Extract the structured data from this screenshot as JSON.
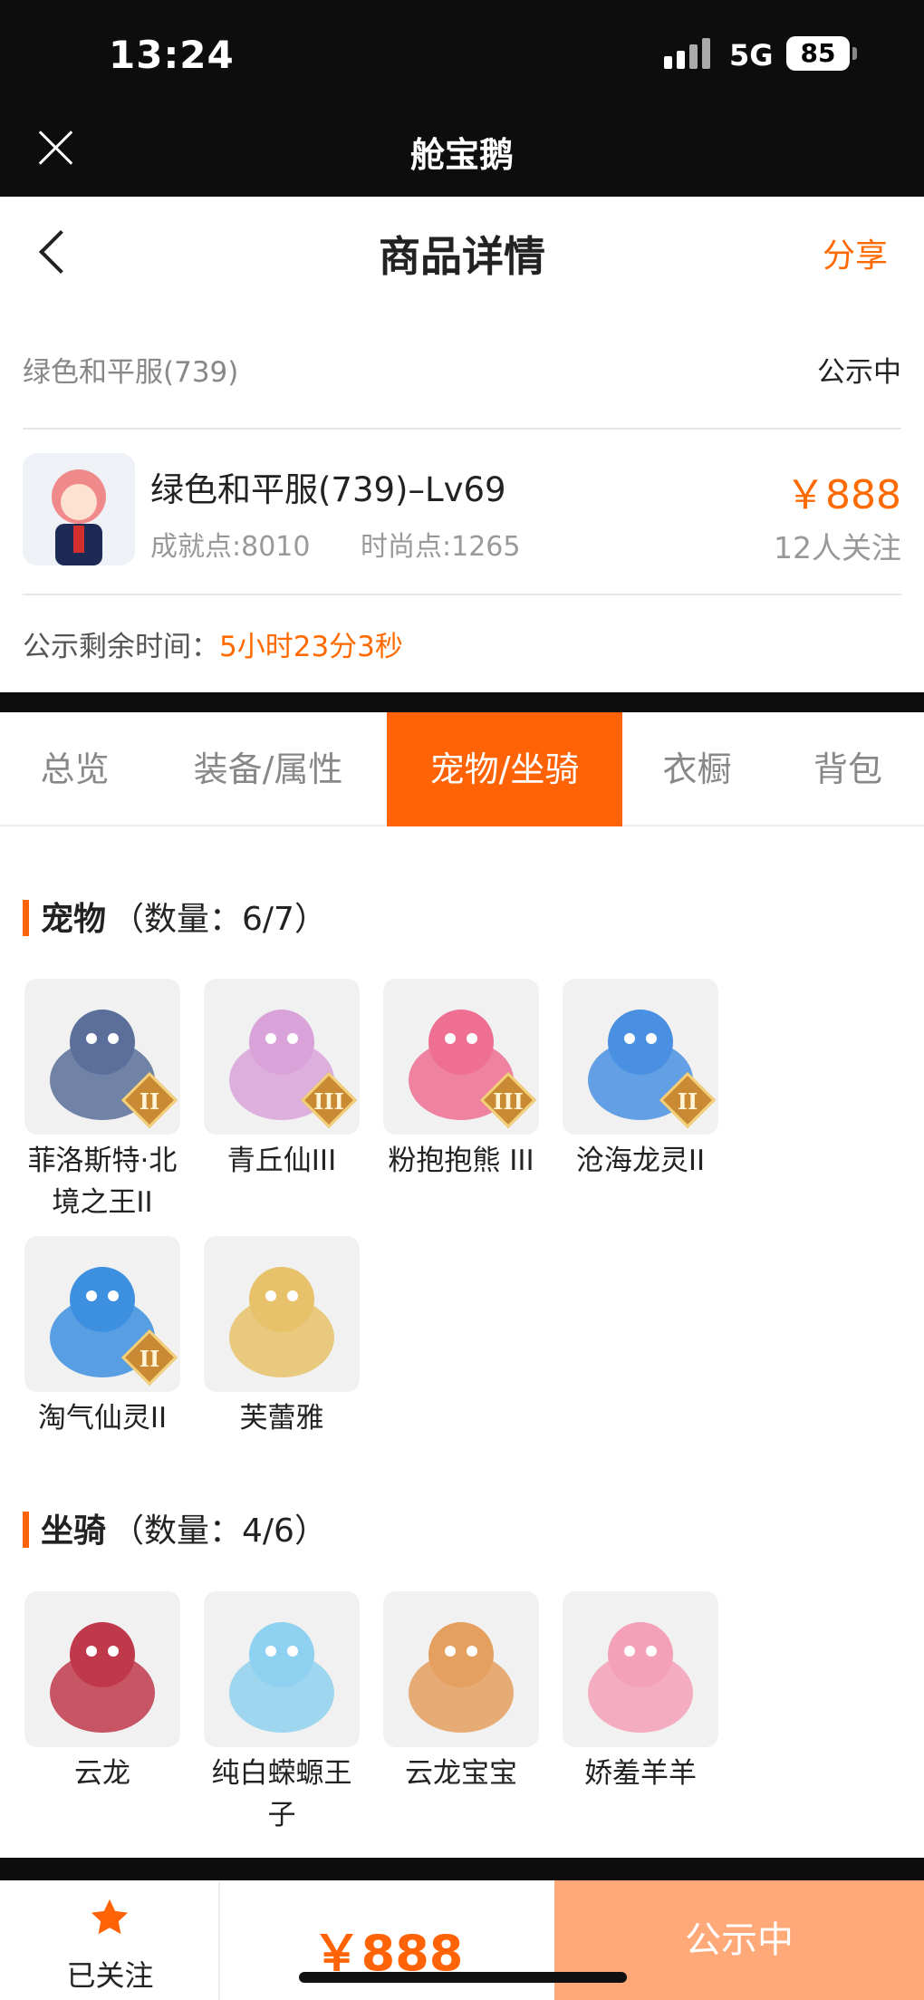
{
  "status_bar": {
    "time": "13:24",
    "network": "5G",
    "battery": "85"
  },
  "app_bar": {
    "title": "舱宝鹅",
    "close_icon": "close-icon"
  },
  "nav": {
    "title": "商品详情",
    "share": "分享",
    "back_icon": "chevron-left-icon"
  },
  "listing": {
    "server": "绿色和平服(739)",
    "status": "公示中",
    "name": "绿色和平服(739)–Lv69",
    "achievement": "成就点:8010",
    "fashion": "时尚点:1265",
    "price": "￥888",
    "followers": "12人关注",
    "remain_label": "公示剩余时间：",
    "remain_value": "5小时23分3秒"
  },
  "tabs": [
    {
      "label": "总览",
      "active": false
    },
    {
      "label": "装备/属性",
      "active": false
    },
    {
      "label": "宠物/坐骑",
      "active": true
    },
    {
      "label": "衣橱",
      "active": false
    },
    {
      "label": "背包",
      "active": false
    }
  ],
  "pets": {
    "title": "宠物",
    "count": "（数量：6/7）",
    "items": [
      {
        "label": "菲洛斯特·北境之王II",
        "tier": "II",
        "color": "#5b6f9a"
      },
      {
        "label": "青丘仙III",
        "tier": "III",
        "color": "#d9a3d9"
      },
      {
        "label": "粉抱抱熊 III",
        "tier": "III",
        "color": "#ef6f93"
      },
      {
        "label": "沧海龙灵II",
        "tier": "II",
        "color": "#4a90e2"
      },
      {
        "label": "淘气仙灵II",
        "tier": "II",
        "color": "#3d8fe0"
      },
      {
        "label": "芙蕾雅",
        "tier": "",
        "color": "#e8c26a"
      }
    ]
  },
  "mounts": {
    "title": "坐骑",
    "count": "（数量：4/6）",
    "items": [
      {
        "label": "云龙",
        "tier": "",
        "color": "#c0394b"
      },
      {
        "label": "纯白蝾螈王子",
        "tier": "",
        "color": "#8fd1f0"
      },
      {
        "label": "云龙宝宝",
        "tier": "",
        "color": "#e5a060"
      },
      {
        "label": "娇羞羊羊",
        "tier": "",
        "color": "#f4a0b8"
      }
    ]
  },
  "bottom_bar": {
    "follow_label": "已关注",
    "price": "￥888",
    "button": "公示中"
  },
  "colors": {
    "accent": "#ff6305",
    "button_disabled": "#ffa979"
  }
}
